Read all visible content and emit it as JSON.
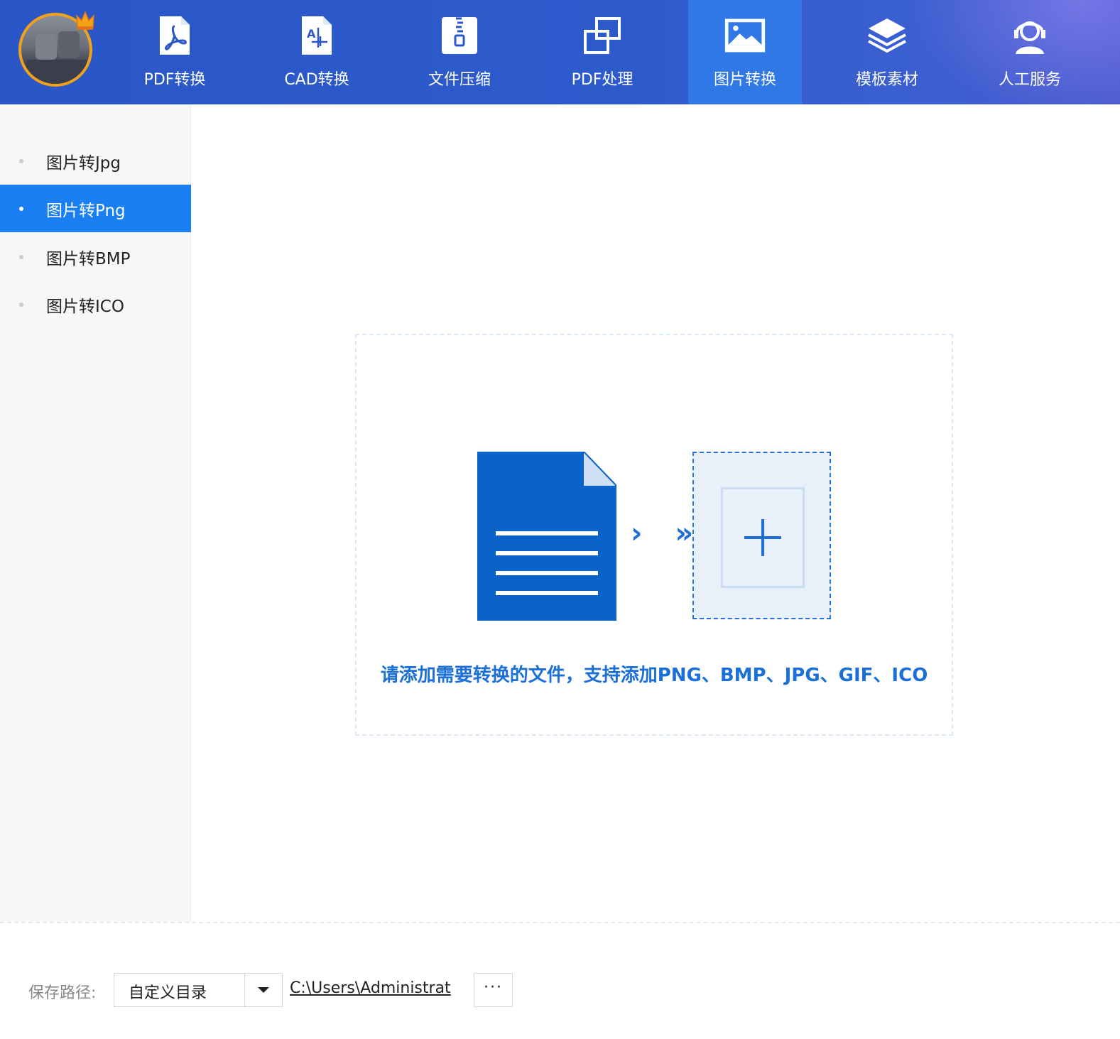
{
  "nav": {
    "items": [
      {
        "label": "PDF转换",
        "icon": "pdf-acrobat-icon"
      },
      {
        "label": "CAD转换",
        "icon": "cad-file-icon"
      },
      {
        "label": "文件压缩",
        "icon": "zip-compress-icon"
      },
      {
        "label": "PDF处理",
        "icon": "overlap-squares-icon"
      },
      {
        "label": "图片转换",
        "icon": "image-icon",
        "active": true
      },
      {
        "label": "模板素材",
        "icon": "layers-icon"
      },
      {
        "label": "人工服务",
        "icon": "headset-support-icon"
      }
    ]
  },
  "sidebar": {
    "items": [
      {
        "label": "图片转Jpg"
      },
      {
        "label": "图片转Png",
        "active": true
      },
      {
        "label": "图片转BMP"
      },
      {
        "label": "图片转ICO"
      }
    ]
  },
  "dropzone": {
    "hint": "请添加需要转换的文件，支持添加PNG、BMP、JPG、GIF、ICO",
    "arrows": "› »"
  },
  "footer": {
    "save_label": "保存路径:",
    "dir_option": "自定义目录",
    "path": "C:\\Users\\Administrat",
    "browse": "···"
  },
  "colors": {
    "topbar": "#2a56c6",
    "accent": "#1a7ff0",
    "nav_active": "#2f78e6",
    "doc_blue": "#0a63c9"
  }
}
